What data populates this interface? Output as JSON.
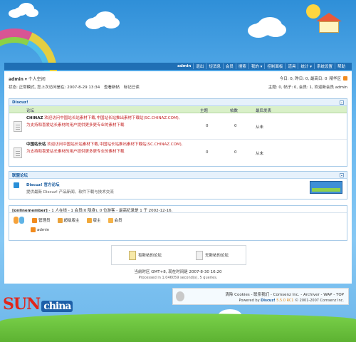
{
  "nav": {
    "items": [
      "admin",
      "退出",
      "短消息",
      "会员",
      "搜索",
      "我的 ▾",
      "控制面板",
      "道具",
      "统计 ▾",
      "系统设置",
      "帮助"
    ]
  },
  "userbar": {
    "username": "admin",
    "arrow": "▾",
    "space_link": "个人空间",
    "status_prefix": "状态: 正常模式, 您上次访问是在: 2007-8-29 13:34",
    "view_new": "查看新帖",
    "mark_read": "标记已读",
    "stats_today": "今日: 0, 昨日: 0, 最高日: 0",
    "digest": "精华区",
    "stats_total": "主题: 0, 帖子: 0, 会员: 1, 欢迎新会员 admin"
  },
  "category": {
    "title": "Discuz!",
    "columns": {
      "forum": "论坛",
      "threads": "主题",
      "posts": "帖数",
      "last": "最后发表"
    },
    "forums": [
      {
        "name": "CHINAZ",
        "desc": " 欢迎访问中国站长站素材下载,中国站长站推出素材下载站(SC.CHINAZ.COM),为支持和喜爱站长素材的用户提供更多更专业的素材下载",
        "threads": "0",
        "posts": "0",
        "last": "从未"
      },
      {
        "name": "中国站长站",
        "desc": " 欢迎访问中国站长站素材下载,中国站长站推出素材下载站(SC.CHINAZ.COM),为支持和喜爱站长素材的用户提供更多更专业的素材下载",
        "threads": "0",
        "posts": "0",
        "last": "从未"
      }
    ]
  },
  "alliance": {
    "title": "联盟论坛",
    "name": "Discuz! 官方论坛",
    "desc": "提供最新 Discuz! 产品新闻、软件下载与技术交流"
  },
  "online": {
    "label": "[onlinemember]",
    "text": " - 1 人在线 - 1 会员(0 隐身), 0 位游客 - 最高纪录是 1 于 2002-12-16.",
    "groups": [
      {
        "label": "管理员",
        "color": "#f28b1e"
      },
      {
        "label": "超级版主",
        "color": "#e9a23b"
      },
      {
        "label": "版主",
        "color": "#f0a93c"
      },
      {
        "label": "会员",
        "color": "#f5b34a"
      }
    ],
    "member": "admin"
  },
  "legend": {
    "new": "有新帖的论坛",
    "nonew": "无新帖的论坛"
  },
  "footer": {
    "time": "当前时区 GMT+8, 现在时间是 2007-8-30 16:20",
    "processed": "Processed in 1.046059 second(s), 5 queries."
  },
  "credits": {
    "links": "清除 Cookies - 联系我们 - Comsenz Inc. - Archiver - WAP - TOP",
    "powered": "Powered by ",
    "product": "Discuz!",
    "version": " 5.5.0 RC1",
    "copyright": " © 2001-2007 Comsenz Inc."
  },
  "brand": {
    "logo": "SUN",
    "logo_suffix": "china"
  }
}
